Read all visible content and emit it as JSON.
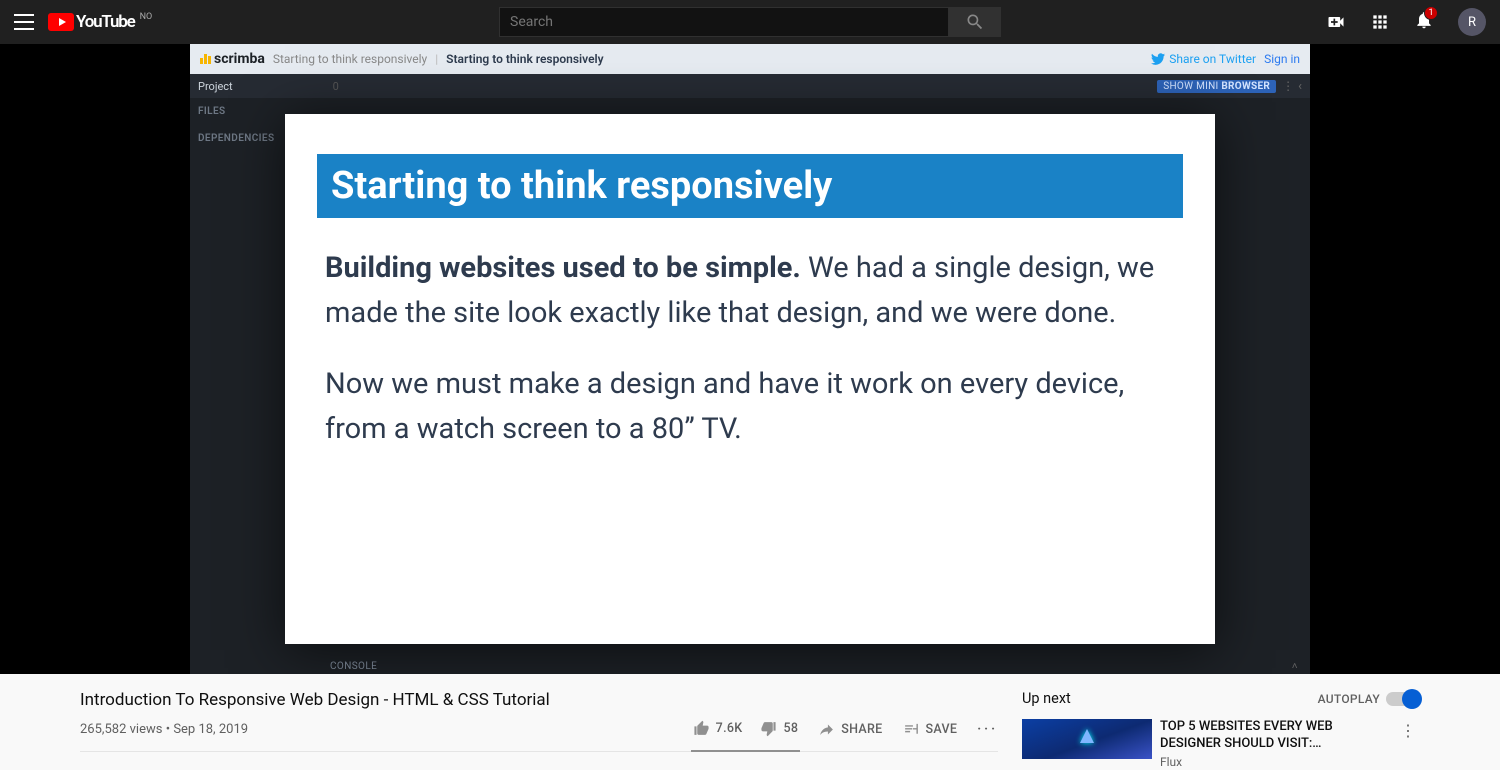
{
  "ytbar": {
    "country": "NO",
    "search_placeholder": "Search",
    "notif_count": "1",
    "avatar_letter": "R"
  },
  "frame": {
    "brand": "scrimba",
    "crumb1": "Starting to think responsively",
    "crumb2": "Starting to think responsively",
    "share_twitter": "Share on Twitter",
    "sign_in": "Sign in",
    "project": "Project",
    "files": "FILES",
    "dependencies": "DEPENDENCIES",
    "show_mini_pre": "SHOW MINI ",
    "show_mini_b": "BROWSER",
    "zero": "0",
    "console": "CONSOLE"
  },
  "slide": {
    "title": "Starting to think responsively",
    "p1b": "Building websites used to be simple.",
    "p1": " We had a single design, we made the site look exactly like that design, and we were done.",
    "p2": "Now we must make a design and have it work on every device, from a watch screen to a 80” TV."
  },
  "video": {
    "title": "Introduction To Responsive Web Design - HTML & CSS Tutorial",
    "views": "265,582 views",
    "date": "Sep 18, 2019",
    "likes": "7.6K",
    "dislikes": "58",
    "share": "SHARE",
    "save": "SAVE"
  },
  "upnext": {
    "heading": "Up next",
    "autoplay": "AUTOPLAY",
    "reco_title": "TOP 5 WEBSITES EVERY WEB DESIGNER SHOULD VISIT:…",
    "reco_channel": "Flux"
  }
}
